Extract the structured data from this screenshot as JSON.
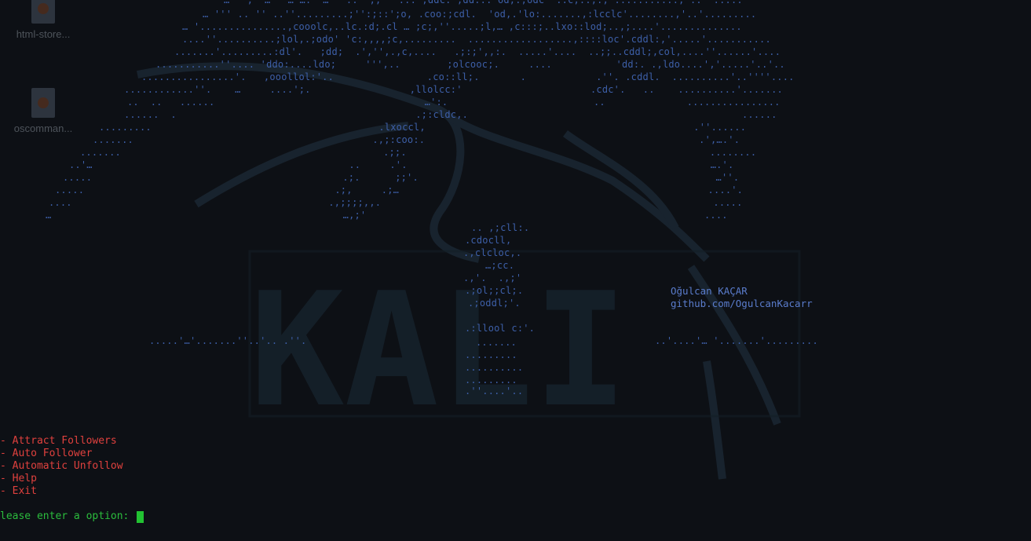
{
  "desktop": {
    "icons": [
      {
        "label": "html-store...",
        "icon": "html-file-icon"
      },
      {
        "label": "oscomman...",
        "icon": "html-file-icon"
      }
    ]
  },
  "banner": {
    "ascii_lines": [
      "…   ,  … ``… ….  …   ..  ,,  `::. ;ddc. ;dd:.. od;.,odc  ::c;..,:; ..........., .. `.....",
      "… ''' .. '' ..''.........;'':;::';o, .coo:;cdl.  'od,.'lo:.......,:lcclc'........,'..'.........",
      "… '...............,cooolc,..lc.:d;.cl … ;c;,''.....;l,… ,c:::;..lxo::lod;..,;....'..............",
      "....''..........;lol,.;odo' 'c:,,,,;c,.........  ..................,::::loc'.cddl:,'.....'...........",
      ".......'.........:dl'.   ;dd;  .','',.,c,....   .;:;',,:.  .....'....  ..;;..cddl;,col,....''......'....",
      "...........''.... 'ddo:....ldo;     ''',..        ;olcooc;.     ....           'dd:. .,ldo....','.....'..'..",
      "................'.   ,ooollol:'..                .co::ll;.       .            .''. .cddl.  ..........'..''''....",
      "............''.    …     ....';.                 ,llolcc:'                      .cdc'.   ..    ..........'.......",
      "..  ..   ......                                    …':.                         ..              ................",
      "......  .                                         .;:cldc,.                                               ......",
      ".........                                       .lxoccl,                                              .''......",
      ".......                                         .,;:coo:.                                               .',….'.",
      ".......                                             .;;.                                                    ........",
      "..'…                                            ..     .'.                                                    ….'.",
      ".....                                           .;.      ;;'.                                                   …''.",
      ".....                                           .;,     .;…                                                     ....'.",
      "....                                            .,;;;;,,.                                                         .....",
      "…                                                  …,;'                                                          ....",
      ".. ,;cll:.",
      ".cdocll,",
      ".,clcloc,.",
      "…;cc.",
      ".,'.  .,;'",
      ".;ol;;cl;.",
      ".;oddl;'.",
      ".:llool c:'.",
      ".......",
      ".........",
      "..........",
      ".........",
      ".''....'.."
    ],
    "bottom_left": ".....'…'.......''..'.. .''.",
    "bottom_right": "..'....'… '.......'........."
  },
  "credits": {
    "author": "Oğulcan KAÇAR",
    "github": "github.com/OgulcanKacarr"
  },
  "menu": {
    "items": [
      {
        "label": "- Attract Followers"
      },
      {
        "label": "- Auto Follower"
      },
      {
        "label": "- Automatic Unfollow"
      },
      {
        "label": "- Help"
      },
      {
        "label": "- Exit"
      }
    ]
  },
  "prompt": {
    "text": "lease enter a option: "
  },
  "colors": {
    "background": "#0d1015",
    "ascii": "#3d5fa8",
    "menu": "#e0413e",
    "prompt": "#2bbd3d",
    "cursor": "#22c232"
  }
}
